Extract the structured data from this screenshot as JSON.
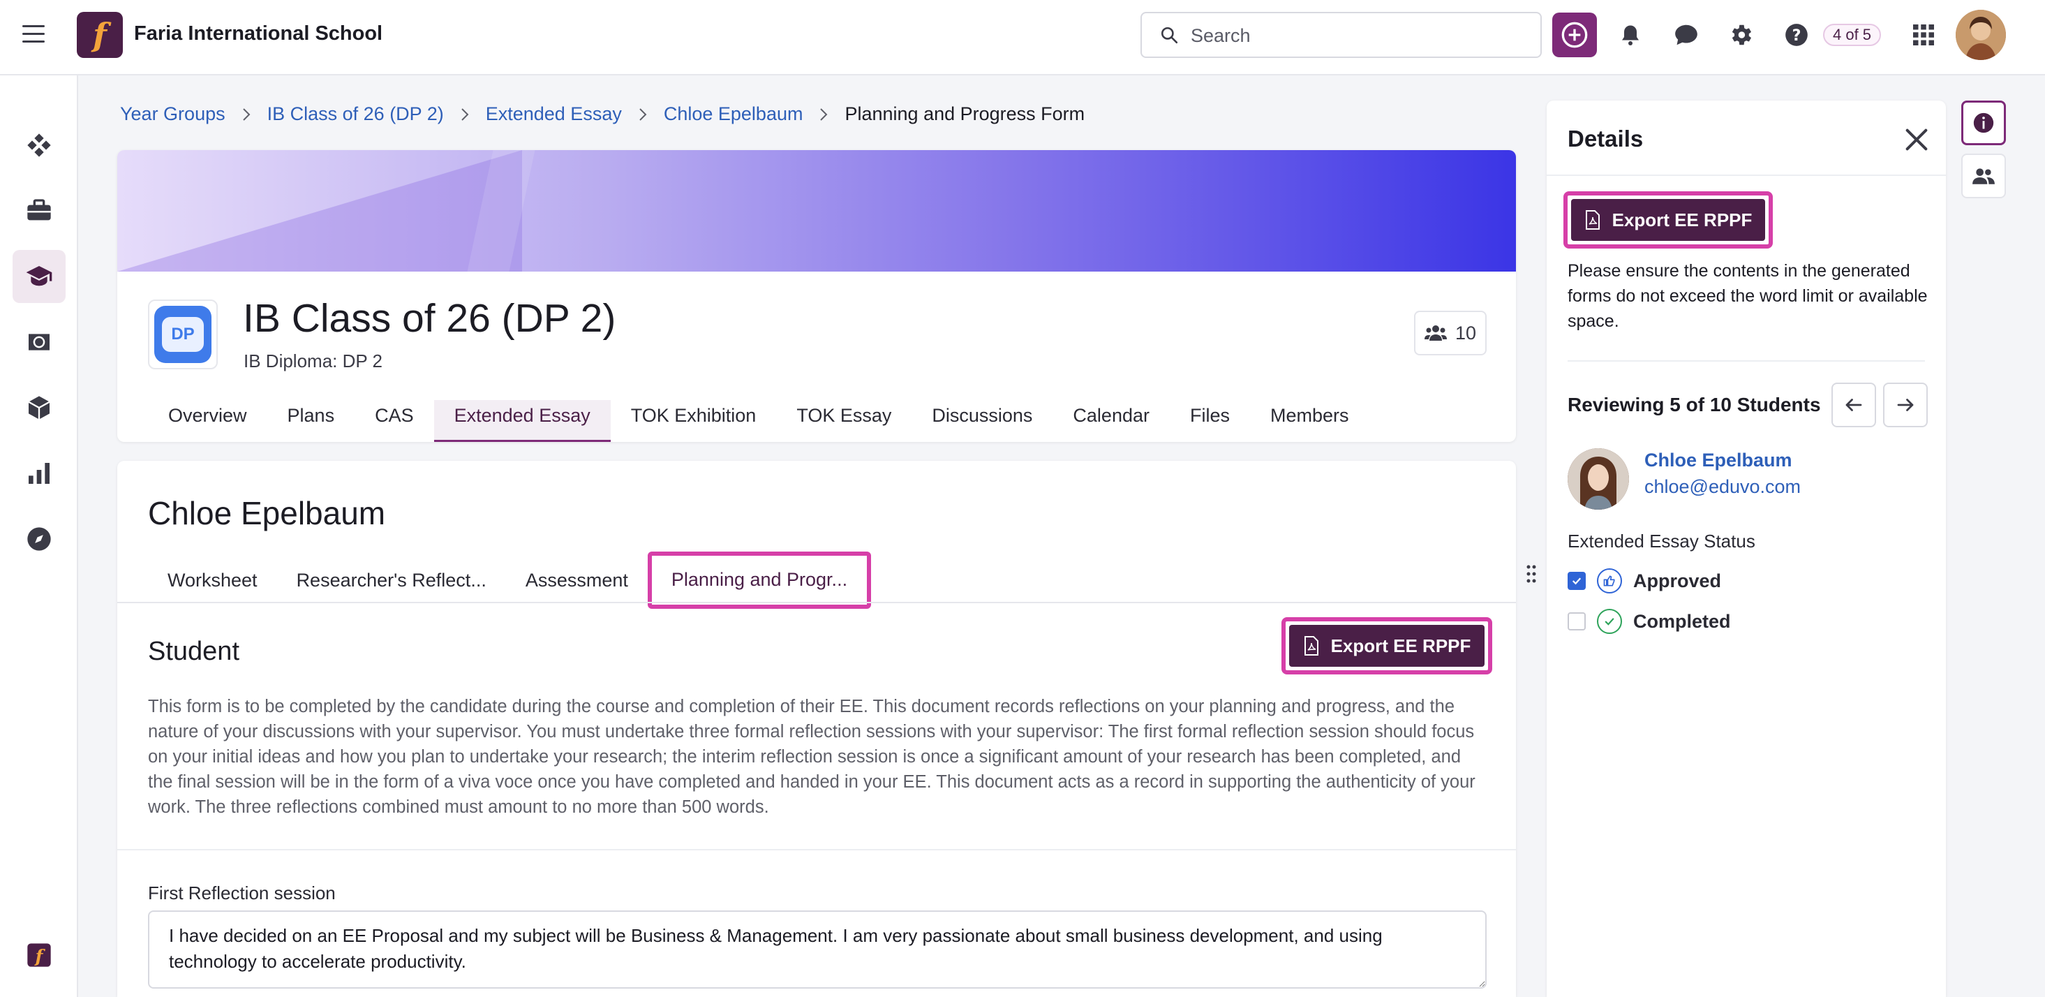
{
  "app": {
    "title": "Faria International School",
    "logo_letter": "f",
    "brand_color": "#4a1f47",
    "accent_color": "#d63fa8"
  },
  "topbar": {
    "search_placeholder": "Search",
    "counter": "4 of 5",
    "icons": [
      "menu-icon",
      "add-icon",
      "bell-icon",
      "chat-icon",
      "gear-icon",
      "help-icon",
      "apps-grid-icon",
      "user-avatar"
    ]
  },
  "leftnav": {
    "icons": [
      "dashboard-icon",
      "briefcase-icon",
      "graduation-cap-icon",
      "globe-icon",
      "cube-icon",
      "bar-chart-icon",
      "compass-icon",
      "faria-logo-icon"
    ],
    "active": "graduation-cap-icon"
  },
  "breadcrumb": {
    "items": [
      "Year Groups",
      "IB Class of 26 (DP 2)",
      "Extended Essay",
      "Chloe Epelbaum"
    ],
    "current": "Planning and Progress Form"
  },
  "class": {
    "badge": "DP",
    "title": "IB Class of 26 (DP 2)",
    "subtitle": "IB Diploma: DP 2",
    "member_count": "10",
    "tabs": [
      "Overview",
      "Plans",
      "CAS",
      "Extended Essay",
      "TOK Exhibition",
      "TOK Essay",
      "Discussions",
      "Calendar",
      "Files",
      "Members"
    ],
    "active_tab": "Extended Essay"
  },
  "student": {
    "name": "Chloe Epelbaum",
    "tabs": [
      "Worksheet",
      "Researcher's Reflect...",
      "Assessment",
      "Planning and Progr..."
    ],
    "active_tab": "Planning and Progr...",
    "section_title": "Student",
    "export_label": "Export EE RPPF",
    "description": "This form is to be completed by the candidate during the course and completion of their EE. This document records reflections on your planning and progress, and the nature of your discussions with your supervisor. You must undertake three formal reflection sessions with your supervisor: The first formal reflection session should focus on your initial ideas and how you plan to undertake your research; the interim reflection session is once a significant amount of your research has been completed, and the final session will be in the form of a viva voce once you have completed and handed in your EE. This document acts as a record in supporting the authenticity of your work. The three reflections combined must amount to no more than 500 words.",
    "first_reflection_label": "First Reflection session",
    "first_reflection_value": "I have decided on an EE Proposal and my subject will be Business & Management. I am very passionate about small business development, and using technology to accelerate productivity."
  },
  "details": {
    "title": "Details",
    "export_label": "Export EE RPPF",
    "note": "Please ensure the contents in the generated forms do not exceed the word limit or available space.",
    "reviewing": "Reviewing 5 of 10 Students",
    "student_name": "Chloe Epelbaum",
    "student_email": "chloe@eduvo.com",
    "status_label": "Extended Essay Status",
    "statuses": [
      {
        "label": "Approved",
        "checked": true
      },
      {
        "label": "Completed",
        "checked": false
      }
    ]
  }
}
